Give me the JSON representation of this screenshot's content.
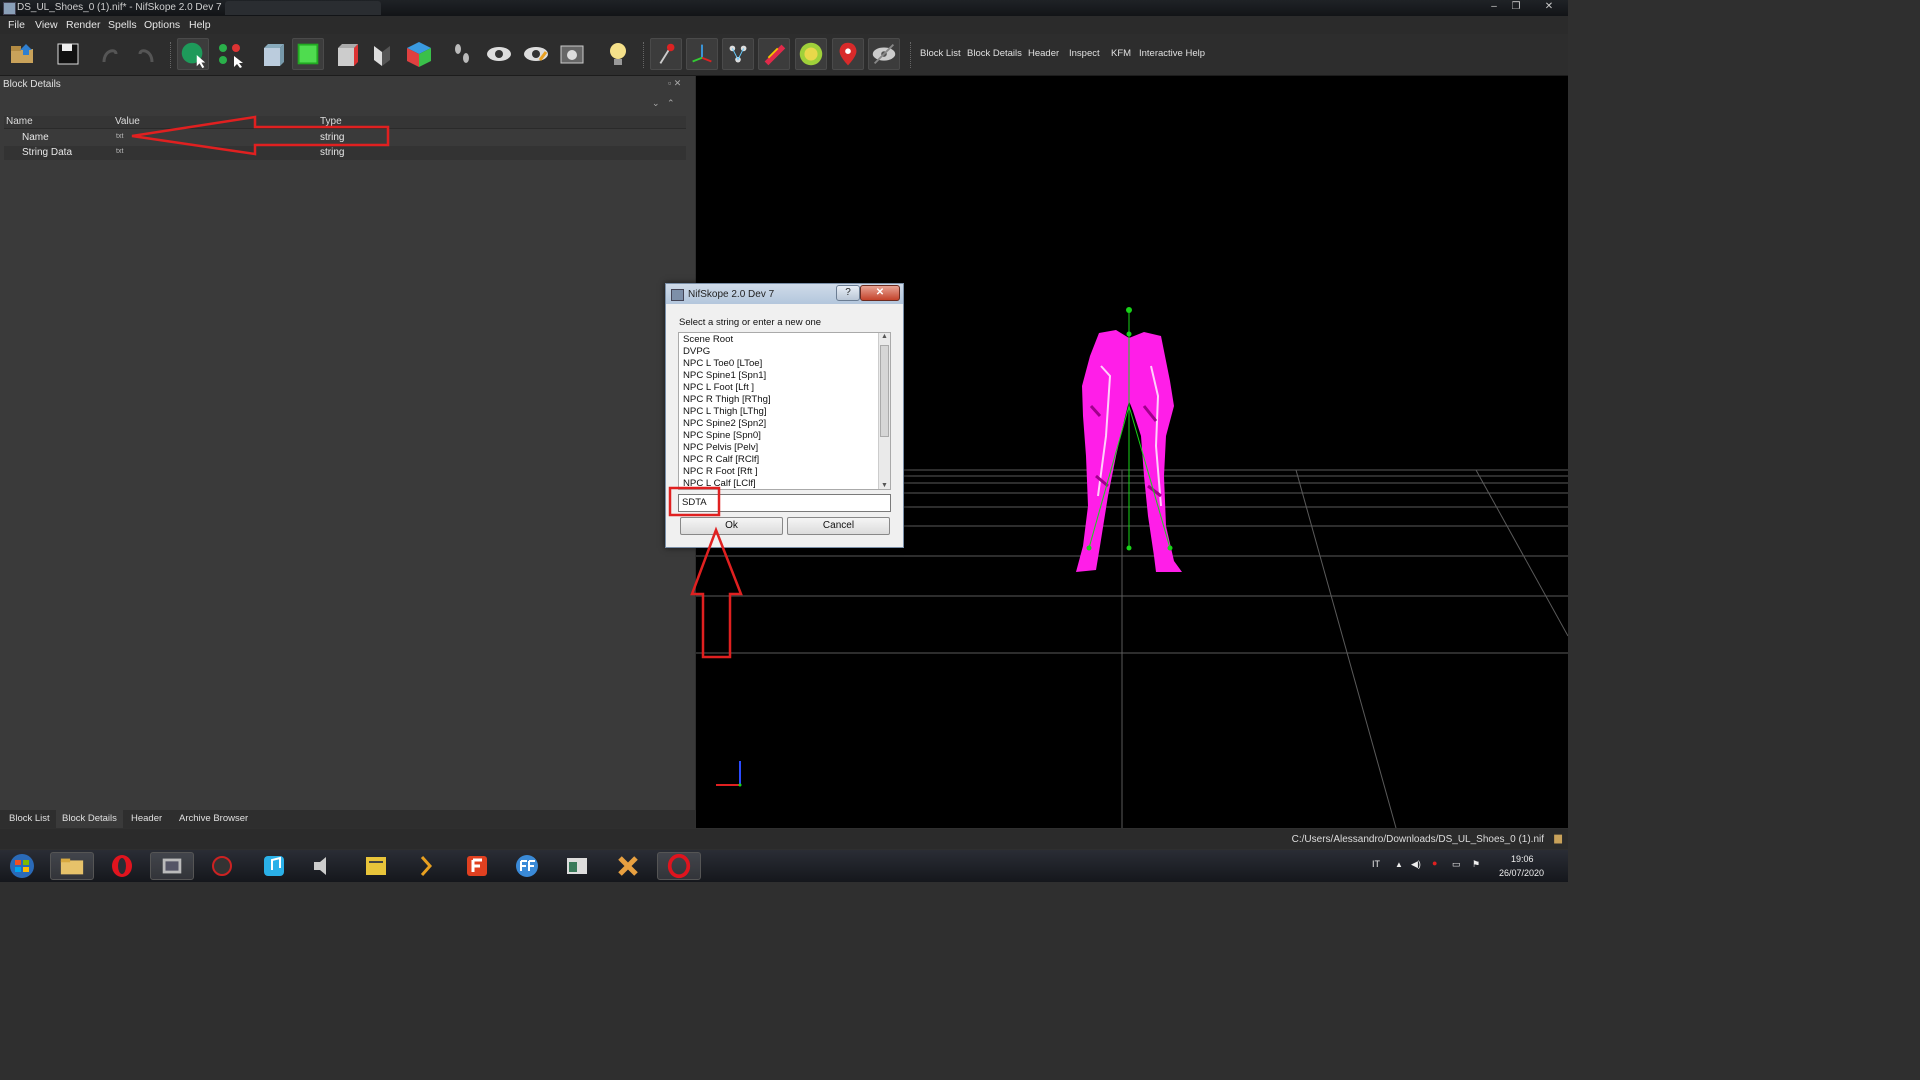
{
  "window": {
    "title": "DS_UL_Shoes_0 (1).nif* - NifSkope 2.0 Dev 7",
    "controls": [
      "–",
      "❐",
      "✕"
    ]
  },
  "menu": [
    "File",
    "View",
    "Render",
    "Spells",
    "Options",
    "Help"
  ],
  "toolbar": {
    "icons": [
      "open-folder-icon",
      "save-icon",
      "undo-icon",
      "redo-icon",
      "select-object-icon",
      "select-vertex-icon",
      "view-front-icon",
      "view-top-icon",
      "view-side-icon",
      "view-user-icon",
      "view-walk-icon",
      "walk-mode-icon",
      "show-hidden-icon",
      "show-nodes-icon",
      "screenshot-icon",
      "lighting-icon",
      "show-axes-icon",
      "show-grid-icon",
      "show-havok-icon",
      "show-constraints-icon",
      "show-markers-icon",
      "show-furniture-icon",
      "show-selection-icon"
    ],
    "docks": [
      "Block List",
      "Block Details",
      "Header",
      "Inspect",
      "KFM",
      "Interactive Help"
    ]
  },
  "block_details": {
    "title": "Block Details",
    "columns": [
      "Name",
      "Value",
      "Type"
    ],
    "rows": [
      {
        "name": "Name",
        "value": "txt",
        "type": "string"
      },
      {
        "name": "String Data",
        "value": "txt",
        "type": "string"
      }
    ]
  },
  "bottom_tabs": [
    "Block List",
    "Block Details",
    "Header",
    "Archive Browser"
  ],
  "status": {
    "path": "C:/Users/Alessandro/Downloads/DS_UL_Shoes_0 (1).nif"
  },
  "dialog": {
    "title": "NifSkope 2.0 Dev 7",
    "help_label": "?",
    "close_label": "✕",
    "prompt": "Select a string or enter a new one",
    "items": [
      "Scene Root",
      "DVPG",
      "NPC L Toe0 [LToe]",
      "NPC Spine1 [Spn1]",
      "NPC L Foot [Lft ]",
      "NPC R Thigh [RThg]",
      "NPC L Thigh [LThg]",
      "NPC Spine2 [Spn2]",
      "NPC Spine [Spn0]",
      "NPC Pelvis [Pelv]",
      "NPC R Calf [RClf]",
      "NPC R Foot [Rft ]",
      "NPC L Calf [LClf]"
    ],
    "input_value": "SDTA",
    "ok_label": "Ok",
    "cancel_label": "Cancel"
  },
  "taskbar": {
    "apps": [
      "windows-start-icon",
      "file-explorer-icon",
      "opera-icon",
      "media-app-icon",
      "spider-app-icon",
      "itunes-icon",
      "audio-app-icon",
      "notes-app-icon",
      "winamp-icon",
      "foxit-icon",
      "format-factory-icon",
      "viewer-app-icon",
      "tool-app-icon",
      "opera-gx-icon"
    ],
    "language": "IT",
    "time": "19:06",
    "date": "26/07/2020"
  },
  "colors": {
    "annotation": "#e02020",
    "model": "#ff1ee8",
    "grid": "#5a5a5a",
    "skeleton": "#19d219"
  }
}
